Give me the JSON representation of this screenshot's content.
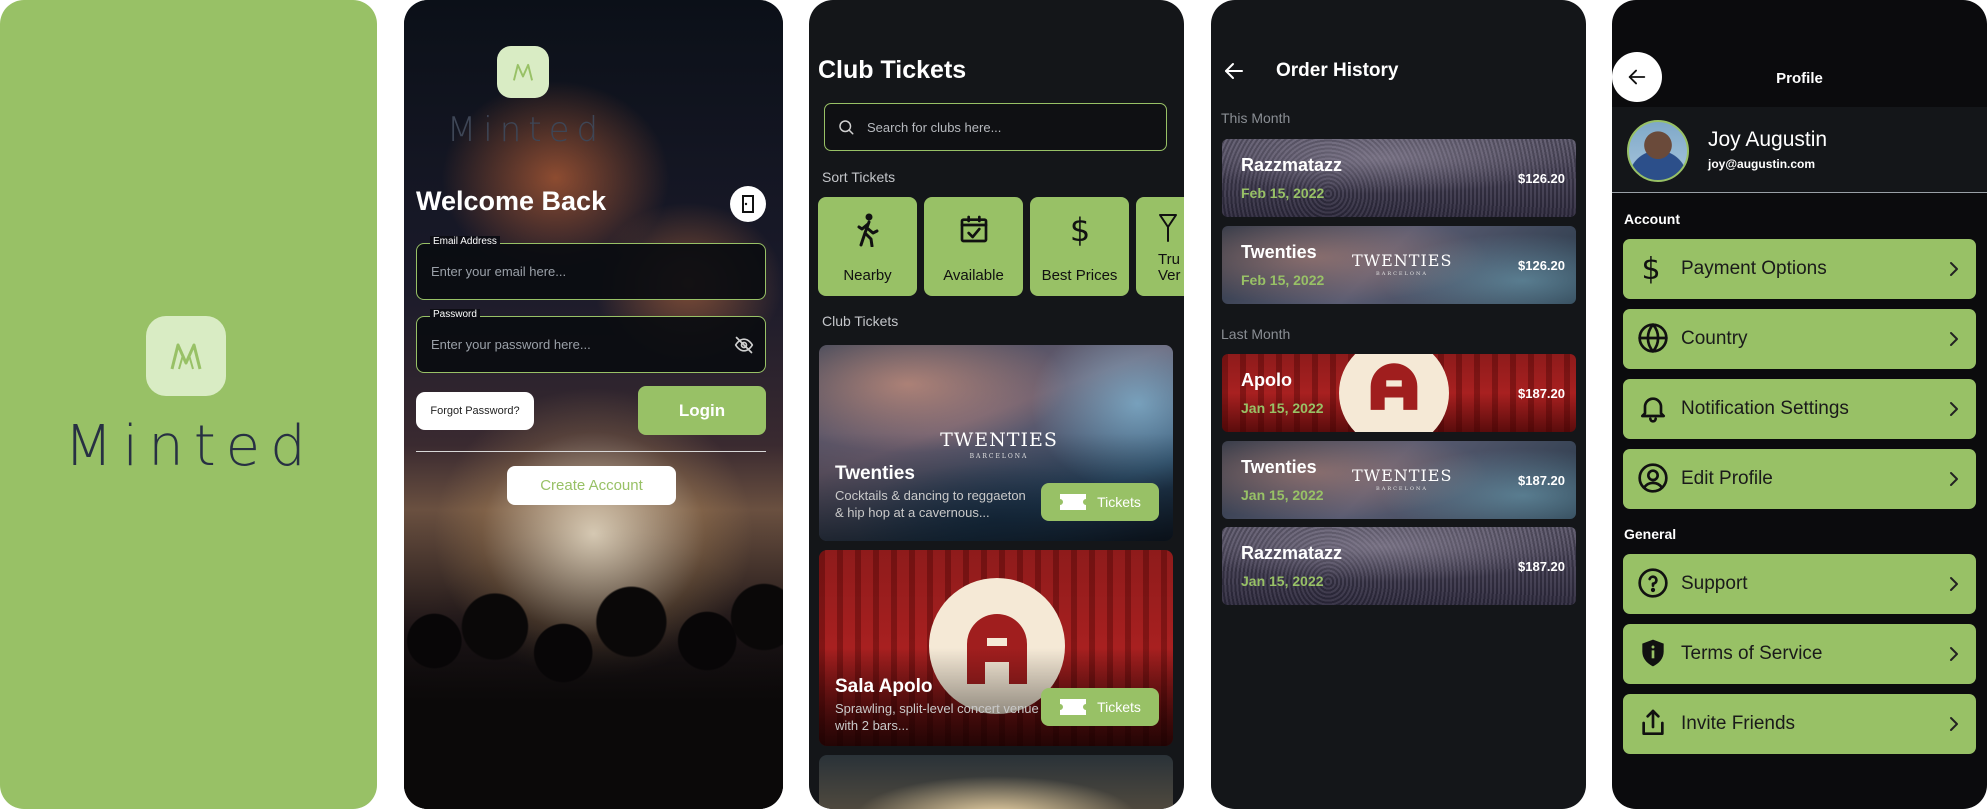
{
  "splash": {
    "brand": "Minted"
  },
  "login": {
    "brand": "Minted",
    "title": "Welcome Back",
    "email_label": "Email Address",
    "email_placeholder": "Enter your email here...",
    "password_label": "Password",
    "password_placeholder": "Enter your password here...",
    "forgot_label": "Forgot Password?",
    "login_label": "Login",
    "create_label": "Create Account"
  },
  "tickets": {
    "title": "Club Tickets",
    "search_placeholder": "Search for clubs here...",
    "sort_label": "Sort Tickets",
    "sort_options": [
      {
        "label": "Nearby",
        "icon": "walk-icon"
      },
      {
        "label": "Available",
        "icon": "calendar-check-icon"
      },
      {
        "label": "Best Prices",
        "icon": "dollar-icon"
      },
      {
        "label": "Tru Ver",
        "icon": "cocktail-icon"
      }
    ],
    "section_label": "Club Tickets",
    "cards": [
      {
        "name": "Twenties",
        "desc": "Cocktails & dancing to reggaeton & hip hop at a cavernous...",
        "logo": "TWENTIES",
        "logo_sub": "BARCELONA",
        "button": "Tickets"
      },
      {
        "name": "Sala Apolo",
        "desc": "Sprawling, split-level concert venue with 2 bars...",
        "button": "Tickets"
      }
    ]
  },
  "orders": {
    "title": "Order History",
    "this_month_label": "This Month",
    "last_month_label": "Last Month",
    "this_month": [
      {
        "name": "Razzmatazz",
        "date": "Feb 15, 2022",
        "price": "$126.20",
        "image": "crowd"
      },
      {
        "name": "Twenties",
        "date": "Feb 15, 2022",
        "price": "$126.20",
        "image": "twenties"
      }
    ],
    "last_month": [
      {
        "name": "Apolo",
        "date": "Jan 15, 2022",
        "price": "$187.20",
        "image": "apolo"
      },
      {
        "name": "Twenties",
        "date": "Jan 15, 2022",
        "price": "$187.20",
        "image": "twenties"
      },
      {
        "name": "Razzmatazz",
        "date": "Jan 15, 2022",
        "price": "$187.20",
        "image": "crowd"
      }
    ],
    "twenties_logo": "TWENTIES",
    "twenties_sub": "BARCELONA"
  },
  "profile": {
    "title": "Profile",
    "user_name": "Joy Augustin",
    "user_email": "joy@augustin.com",
    "account_label": "Account",
    "general_label": "General",
    "account_items": [
      {
        "label": "Payment Options",
        "icon": "dollar-icon"
      },
      {
        "label": "Country",
        "icon": "globe-icon"
      },
      {
        "label": "Notification Settings",
        "icon": "bell-icon"
      },
      {
        "label": "Edit Profile",
        "icon": "user-circle-icon"
      }
    ],
    "general_items": [
      {
        "label": "Support",
        "icon": "help-circle-icon"
      },
      {
        "label": "Terms of Service",
        "icon": "shield-icon"
      },
      {
        "label": "Invite Friends",
        "icon": "share-icon"
      }
    ]
  },
  "colors": {
    "accent": "#98c166",
    "logo_tile": "#d9ecc4",
    "logo_text": "#273043",
    "dark_bg": "#141619"
  }
}
